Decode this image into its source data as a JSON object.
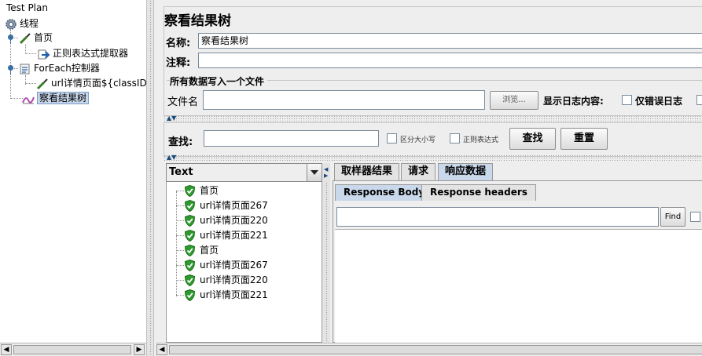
{
  "tree": {
    "root_label": "Test Plan",
    "thread_label": "线程",
    "items": [
      {
        "label": "首页"
      },
      {
        "label": "正则表达式提取器"
      },
      {
        "label": "ForEach控制器"
      },
      {
        "label": "url详情页面${classID}"
      },
      {
        "label": "察看结果树"
      }
    ]
  },
  "panel": {
    "title": "察看结果树",
    "name_label": "名称:",
    "name_value": "察看结果树",
    "comment_label": "注释:",
    "comment_value": "",
    "file_group_title": "所有数据写入一个文件",
    "file_label": "文件名",
    "file_value": "",
    "browse_button": "浏览...",
    "log_label": "显示日志内容:",
    "errors_only_label": "仅错误日志"
  },
  "search": {
    "label": "查找:",
    "value": "",
    "case_label": "区分大小写",
    "regex_label": "正则表达式",
    "find_button": "查找",
    "reset_button": "重置"
  },
  "renderer": {
    "selected": "Text"
  },
  "results": [
    {
      "label": "首页",
      "status": "success"
    },
    {
      "label": "url详情页面267",
      "status": "success"
    },
    {
      "label": "url详情页面220",
      "status": "success"
    },
    {
      "label": "url详情页面221",
      "status": "success"
    },
    {
      "label": "首页",
      "status": "success"
    },
    {
      "label": "url详情页面267",
      "status": "success"
    },
    {
      "label": "url详情页面220",
      "status": "success"
    },
    {
      "label": "url详情页面221",
      "status": "success"
    }
  ],
  "tabs": [
    "取样器结果",
    "请求",
    "响应数据"
  ],
  "active_tab": "响应数据",
  "subtabs": [
    "Response Body",
    "Response headers"
  ],
  "active_subtab": "Response Body",
  "response": {
    "search_value": "",
    "find_button": "Find"
  },
  "colors": {
    "success_shield": "#2e9a2e",
    "selection": "#c8d7ec",
    "active_tab": "#c9d8ea"
  }
}
